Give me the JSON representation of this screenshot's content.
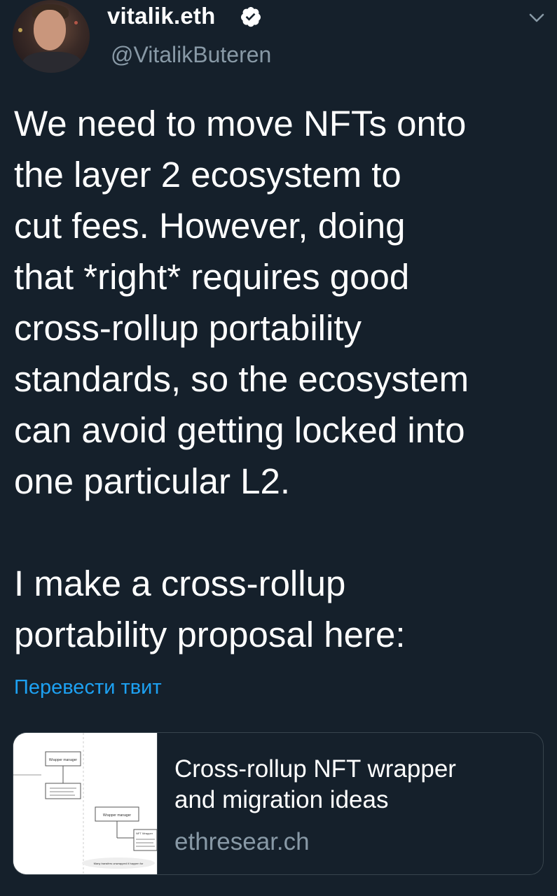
{
  "author": {
    "display_name": "vitalik.eth",
    "handle": "@VitalikButeren"
  },
  "tweet": {
    "text": "We need to move NFTs onto\nthe layer 2 ecosystem to\ncut fees. However, doing\nthat *right* requires good\ncross-rollup portability\nstandards, so the ecosystem\ncan avoid getting locked into\none particular L2.\n\nI make a cross-rollup\nportability proposal here:"
  },
  "translate_label": "Перевести твит",
  "card": {
    "title": "Cross-rollup NFT wrapper\nand migration ideas",
    "domain": "ethresear.ch",
    "thumbnail": {
      "box1": "Wrapper manager",
      "box2": "Wrapper manager",
      "box3": "NFT Wrapper",
      "footer": "Many transfers unwrapped it happen for"
    }
  },
  "icons": {
    "verified": "verified-badge-icon",
    "menu": "chevron-down-icon"
  },
  "colors": {
    "background": "#15202b",
    "text_primary": "#ffffff",
    "text_secondary": "#8899a6",
    "link": "#1da1f2",
    "border": "#38444d"
  }
}
